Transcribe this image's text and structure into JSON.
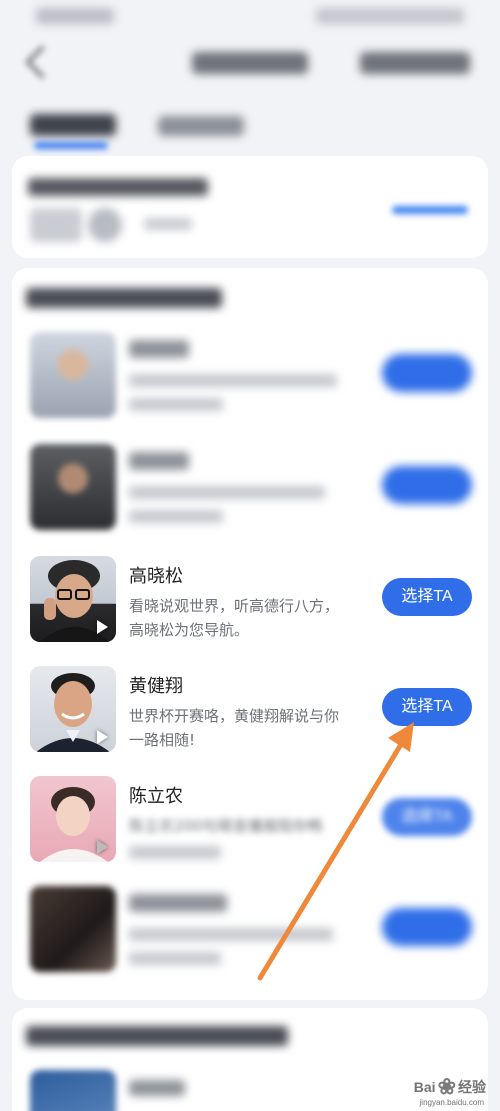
{
  "voices": [
    {
      "name": "高晓松",
      "desc": "看晓说观世界，听高德行八方，高晓松为您导航。",
      "button": "选择TA"
    },
    {
      "name": "黄健翔",
      "desc": "世界杯开赛咯，黄健翔解说与你一路相随!",
      "button": "选择TA"
    },
    {
      "name": "陈立农",
      "desc": "陈立农200句萌音播报陪你畅",
      "button": "选择TA"
    }
  ],
  "watermark": {
    "brand": "Bai",
    "brand2": "经验",
    "sub": "jingyan.baidu.com"
  },
  "colors": {
    "accent": "#2f6ee8",
    "arrow": "#f0883a",
    "background": "#f1f3f6"
  }
}
